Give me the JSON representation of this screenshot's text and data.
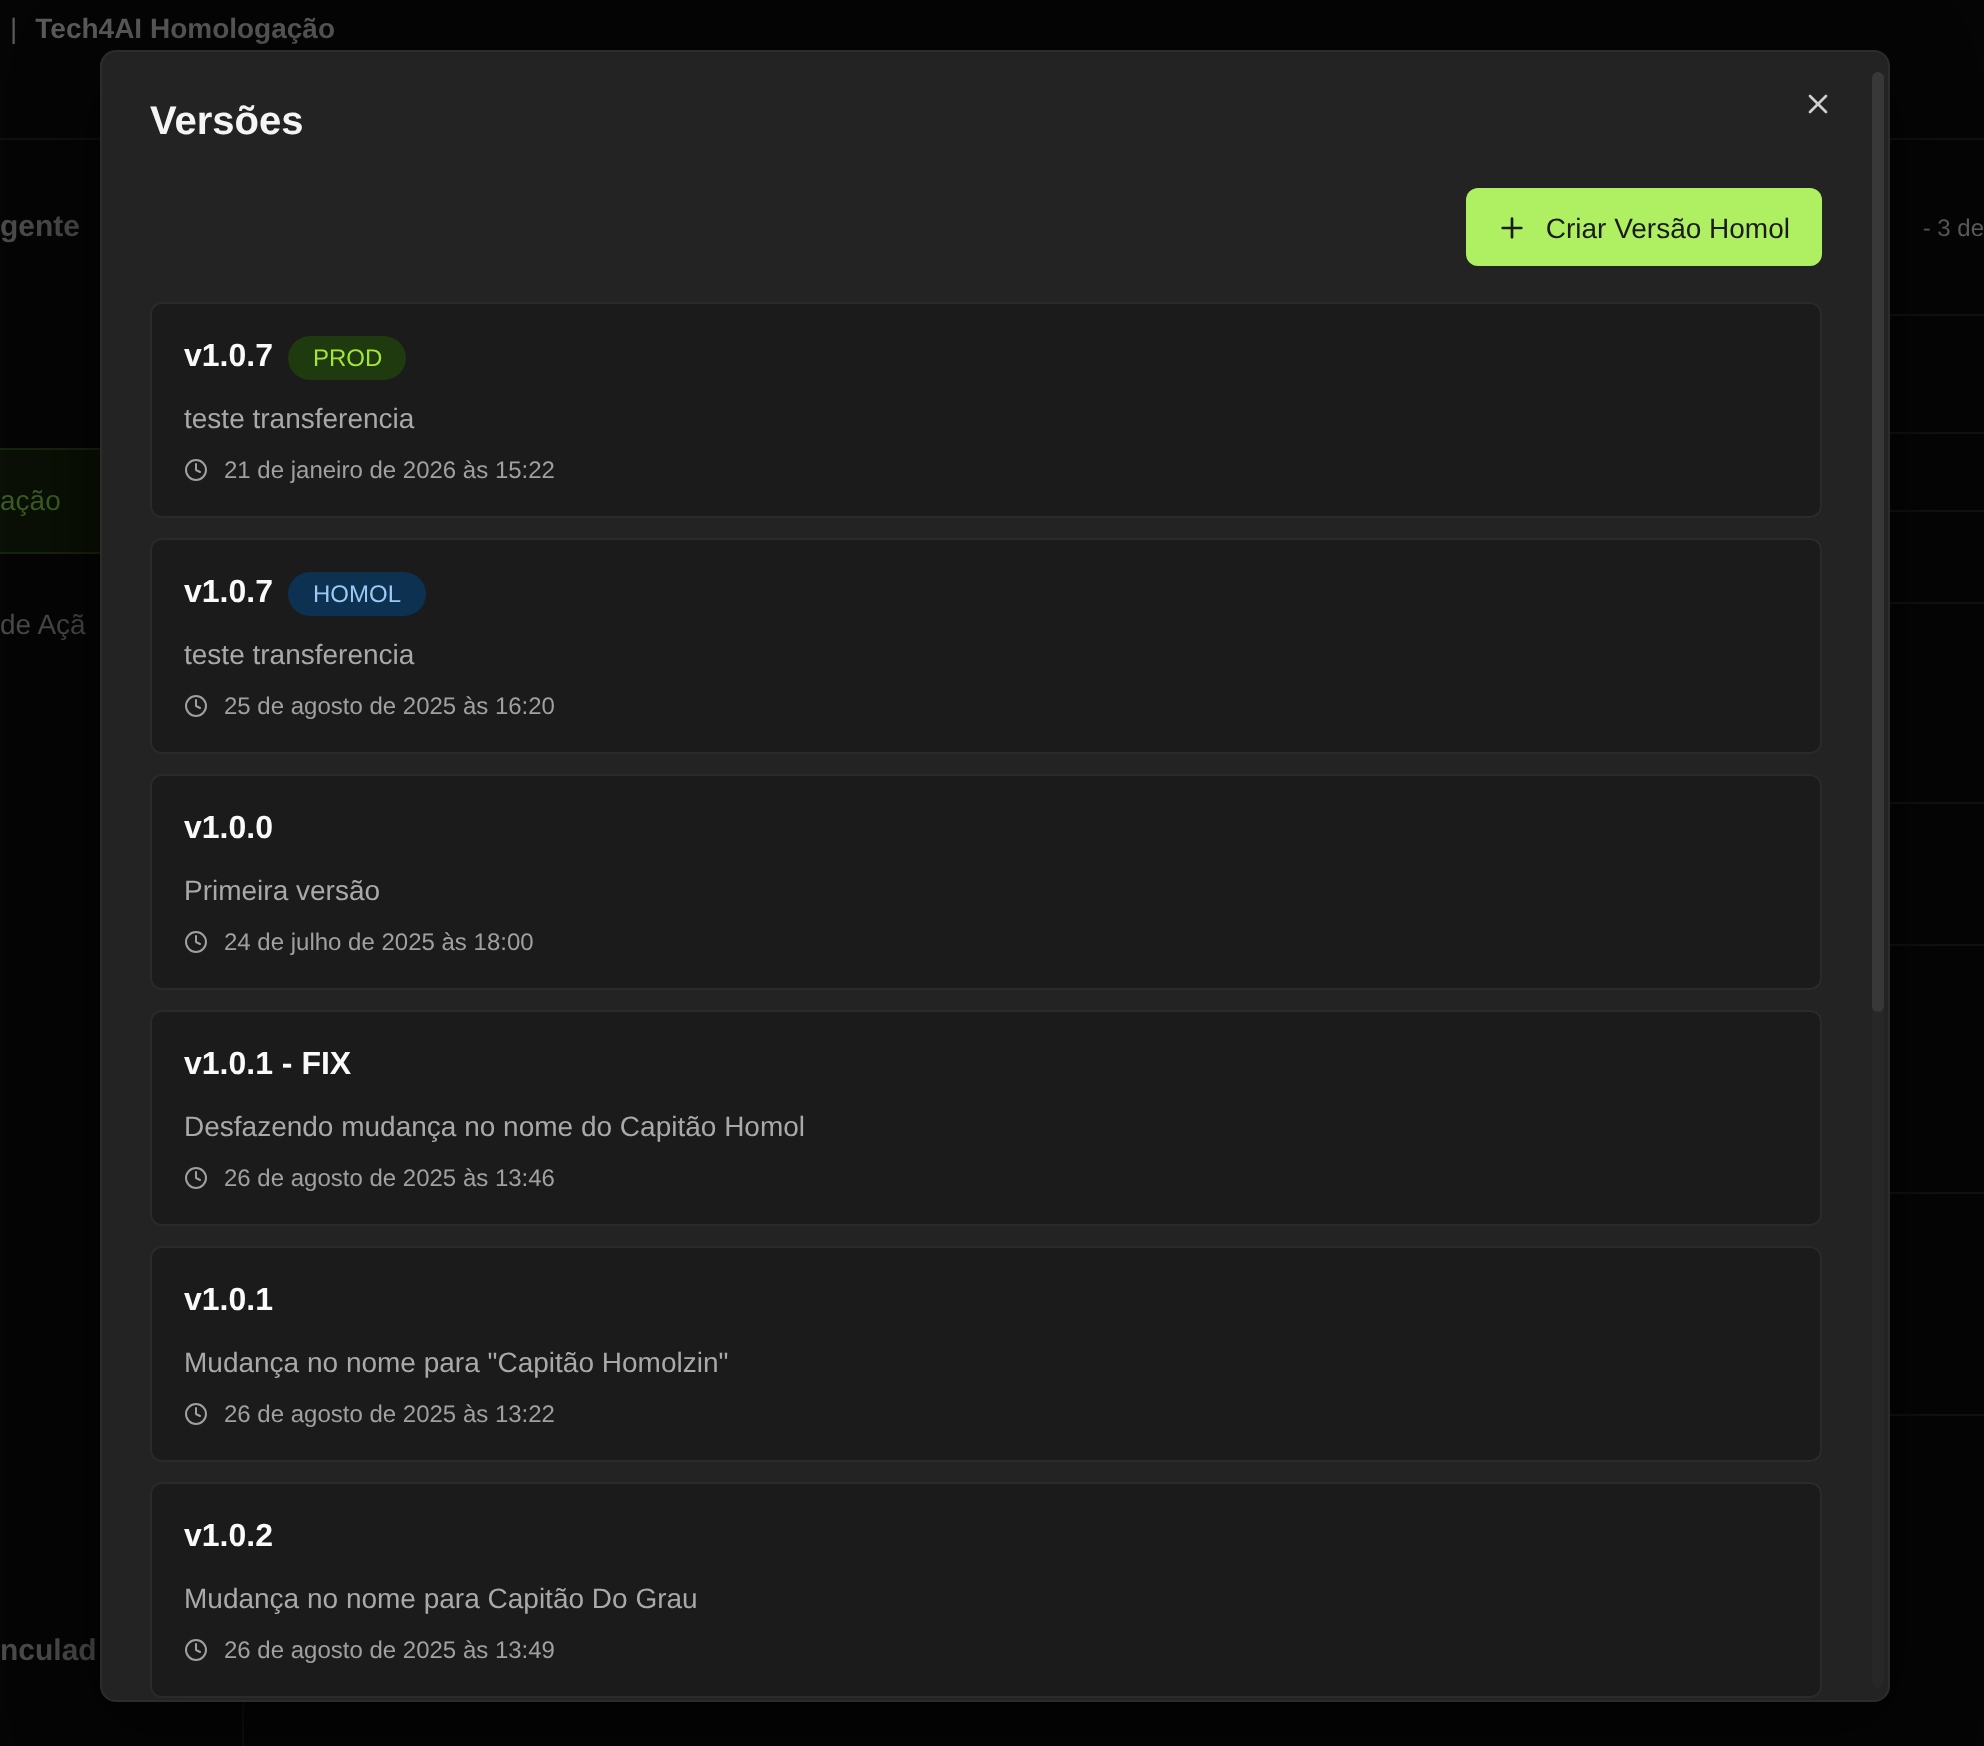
{
  "page": {
    "header": {
      "separator": "|",
      "title": "Tech4AI Homologação"
    },
    "sidebar": [
      {
        "label": "gente",
        "kind": "heading"
      },
      {
        "label": "ação",
        "kind": "highlight"
      },
      {
        "label": "de Açã",
        "kind": "text"
      },
      {
        "label": "nculad",
        "kind": "heading"
      }
    ],
    "pager_text": "- 3 de"
  },
  "dialog": {
    "title": "Versões",
    "create_button": "Criar Versão Homol",
    "versions": [
      {
        "name": "v1.0.7",
        "badge": {
          "label": "PROD",
          "kind": "prod"
        },
        "description": "teste transferencia",
        "date": "21 de janeiro de 2026 às 15:22"
      },
      {
        "name": "v1.0.7",
        "badge": {
          "label": "HOMOL",
          "kind": "homol"
        },
        "description": "teste transferencia",
        "date": "25 de agosto de 2025 às 16:20"
      },
      {
        "name": "v1.0.0",
        "description": "Primeira versão",
        "date": "24 de julho de 2025 às 18:00"
      },
      {
        "name": "v1.0.1 - FIX",
        "description": "Desfazendo mudança no nome do Capitão Homol",
        "date": "26 de agosto de 2025 às 13:46"
      },
      {
        "name": "v1.0.1",
        "description": "Mudança no nome para \"Capitão Homolzin\"",
        "date": "26 de agosto de 2025 às 13:22"
      },
      {
        "name": "v1.0.2",
        "description": "Mudança no nome para Capitão Do Grau",
        "date": "26 de agosto de 2025 às 13:49"
      }
    ]
  }
}
